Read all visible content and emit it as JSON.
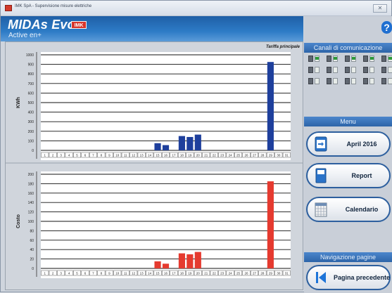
{
  "window": {
    "title": "IMK SpA - Supervisione misure elettriche",
    "close_label": "✕"
  },
  "header": {
    "brand": "MIDAs Evo",
    "badge": "IMK",
    "subtitle": "Active en+"
  },
  "legend_label": "Tariffa principale",
  "sidebar": {
    "help_label": "?",
    "channels_title": "Canali di comunicazione",
    "menu_title": "Menu",
    "nav_title": "Navigazione pagine",
    "buttons": {
      "month": "April 2016",
      "report": "Report",
      "calendar": "Calendario",
      "prev_page": "Pagina precedente"
    }
  },
  "colors": {
    "accent": "#2d64a8",
    "kwh_bar": "#1e3f9c",
    "cost_bar": "#e53a2f",
    "header": "#1f5fa6"
  },
  "icons": {
    "app": "imk-app-icon",
    "help": "question-mark-icon",
    "month": "calendar-page-icon",
    "report": "report-document-icon",
    "calendar": "calendar-grid-icon",
    "prev": "skip-back-icon"
  },
  "chart_data": [
    {
      "type": "bar",
      "ylabel": "KWh",
      "ylim": [
        0,
        1000
      ],
      "yticks": [
        0,
        100,
        200,
        300,
        400,
        500,
        600,
        700,
        800,
        900,
        1000
      ],
      "categories": [
        "1",
        "2",
        "3",
        "4",
        "5",
        "6",
        "7",
        "8",
        "9",
        "10",
        "11",
        "12",
        "13",
        "14",
        "15",
        "16",
        "17",
        "18",
        "19",
        "20",
        "21",
        "22",
        "23",
        "24",
        "25",
        "26",
        "27",
        "28",
        "29",
        "30",
        "31"
      ],
      "values": [
        0,
        0,
        0,
        0,
        0,
        0,
        0,
        0,
        0,
        0,
        0,
        0,
        0,
        0,
        75,
        55,
        0,
        150,
        140,
        165,
        0,
        0,
        0,
        0,
        0,
        0,
        0,
        0,
        925,
        0,
        0
      ],
      "color": "#1e3f9c"
    },
    {
      "type": "bar",
      "ylabel": "Costo",
      "ylim": [
        0,
        200
      ],
      "yticks": [
        0,
        20,
        40,
        60,
        80,
        100,
        120,
        140,
        160,
        180,
        200
      ],
      "categories": [
        "1",
        "2",
        "3",
        "4",
        "5",
        "6",
        "7",
        "8",
        "9",
        "10",
        "11",
        "12",
        "13",
        "14",
        "15",
        "16",
        "17",
        "18",
        "19",
        "20",
        "21",
        "22",
        "23",
        "24",
        "25",
        "26",
        "27",
        "28",
        "29",
        "30",
        "31"
      ],
      "values": [
        0,
        0,
        0,
        0,
        0,
        0,
        0,
        0,
        0,
        0,
        0,
        0,
        0,
        0,
        15,
        10,
        0,
        32,
        30,
        35,
        0,
        0,
        0,
        0,
        0,
        0,
        0,
        0,
        185,
        0,
        0
      ],
      "color": "#e53a2f"
    }
  ]
}
